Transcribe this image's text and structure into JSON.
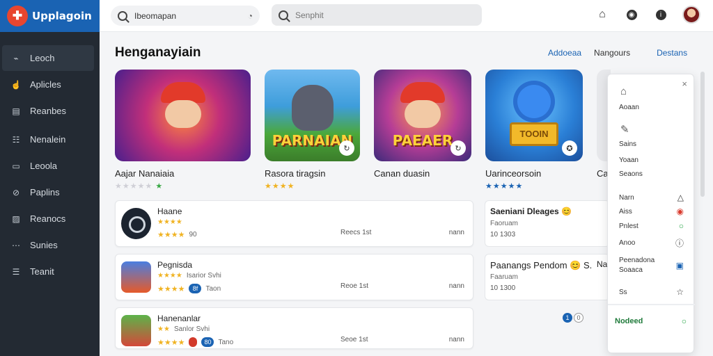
{
  "app": {
    "name": "Upplagoin",
    "logo_icon": "app-logo-icon"
  },
  "sidebar": {
    "items": [
      {
        "label": "Leoch",
        "icon": "chart-icon"
      },
      {
        "label": "Aplicles",
        "icon": "thumb-icon"
      },
      {
        "label": "Reanbes",
        "icon": "document-icon"
      },
      {
        "label": "Nenalein",
        "icon": "list-icon"
      },
      {
        "label": "Leoola",
        "icon": "page-icon"
      },
      {
        "label": "Paplins",
        "icon": "link-icon"
      },
      {
        "label": "Reanocs",
        "icon": "image-icon"
      },
      {
        "label": "Sunies",
        "icon": "dots-icon"
      },
      {
        "label": "Teanit",
        "icon": "sliders-icon"
      }
    ]
  },
  "header": {
    "search_primary": {
      "value": "Ibeomapan",
      "icon": "search-icon",
      "mic_icon": "mic-icon"
    },
    "search_secondary": {
      "placeholder": "Senphit",
      "icon": "search-icon"
    },
    "icons": [
      "home-icon",
      "location-icon",
      "info-icon",
      "avatar"
    ]
  },
  "main": {
    "title": "Henganayiain",
    "tabs": [
      "Addoeaa",
      "Nangours",
      "Destans"
    ],
    "featured": [
      {
        "title": "Aajar Nanaiaia",
        "stars": "★★★★★",
        "banner": ""
      },
      {
        "title": "Rasora tiragsin",
        "stars": "★★★★",
        "banner": "PARNAIAN"
      },
      {
        "title": "Canan duasin",
        "stars": "",
        "banner": "PAEAER"
      },
      {
        "title": "Uarinceorsoin",
        "stars": "★★★★★",
        "banner": "TOOIN"
      },
      {
        "title": "Ca",
        "stars": "",
        "banner": ""
      }
    ],
    "list": [
      {
        "name": "Haane",
        "stars": "★★★★",
        "meta_stars": "★★★★",
        "meta_extra": "90",
        "size": "Reecs 1st",
        "end": "nann"
      },
      {
        "name": "Pegnisda",
        "stars": "★★★★",
        "sub": "Isarior Svhi",
        "meta_stars": "★★★★",
        "pill": "8f",
        "meta_extra": "Taon",
        "size": "Reoe 1st",
        "end": "nann"
      },
      {
        "name": "Hanenanlar",
        "stars": "★★",
        "sub": "Sanlor Svhi",
        "meta_stars": "★★★★",
        "pill": "80",
        "meta_extra": "Tano",
        "size": "Seoe 1st",
        "end": "nann"
      }
    ],
    "list_right": [
      {
        "name": "Saeniani Dleages 😊",
        "sub": "Faoruam",
        "sub2": "10 1303"
      },
      {
        "name": "Paanangs Pendom 😊 S.",
        "sub": "Faaruam",
        "sub2": "10 1300"
      }
    ],
    "chip_labels": [
      "1",
      "0"
    ],
    "side_label": "Na"
  },
  "panel": {
    "close": "×",
    "items": [
      {
        "label": "Aoaan",
        "icon": "home-icon"
      },
      {
        "label": "Sains",
        "icon": "edit-icon"
      },
      {
        "label": "Yoaan",
        "icon": ""
      },
      {
        "label": "Seaons",
        "icon": ""
      }
    ],
    "rows": [
      {
        "label": "Narn",
        "glyph": "△"
      },
      {
        "label": "Aiss",
        "glyph": "◉"
      },
      {
        "label": "Pnlest",
        "glyph": "○"
      },
      {
        "label": "Anoo",
        "glyph": "ⓘ"
      },
      {
        "label": "Peenadona Soaaca",
        "glyph": "▣"
      },
      {
        "label": "Ss",
        "glyph": "☆"
      }
    ],
    "footer": {
      "label": "Nodeed",
      "glyph": "○"
    }
  }
}
